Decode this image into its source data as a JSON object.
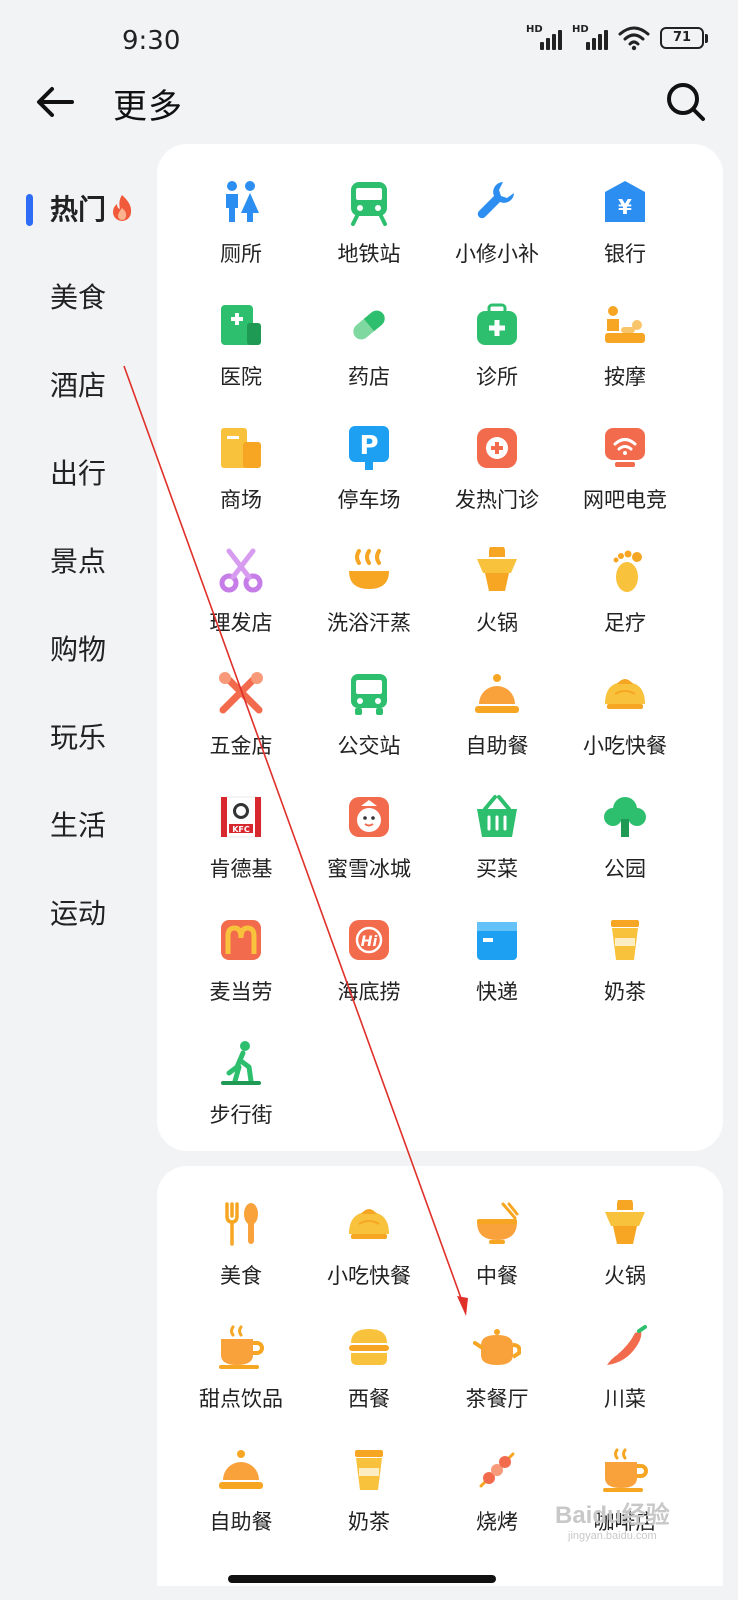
{
  "status_bar": {
    "time": "9:30",
    "signal1_label": "HD",
    "signal2_label": "HD",
    "battery": "71"
  },
  "header": {
    "title": "更多"
  },
  "sidebar": {
    "items": [
      {
        "label": "热门",
        "active": true
      },
      {
        "label": "美食"
      },
      {
        "label": "酒店"
      },
      {
        "label": "出行"
      },
      {
        "label": "景点"
      },
      {
        "label": "购物"
      },
      {
        "label": "玩乐"
      },
      {
        "label": "生活"
      },
      {
        "label": "运动"
      }
    ]
  },
  "hot_section": {
    "items": [
      {
        "label": "厕所",
        "icon": "toilet-icon"
      },
      {
        "label": "地铁站",
        "icon": "subway-icon"
      },
      {
        "label": "小修小补",
        "icon": "wrench-icon"
      },
      {
        "label": "银行",
        "icon": "bank-icon"
      },
      {
        "label": "医院",
        "icon": "hospital-icon"
      },
      {
        "label": "药店",
        "icon": "pill-icon"
      },
      {
        "label": "诊所",
        "icon": "clinic-icon"
      },
      {
        "label": "按摩",
        "icon": "massage-icon"
      },
      {
        "label": "商场",
        "icon": "mall-icon"
      },
      {
        "label": "停车场",
        "icon": "parking-icon"
      },
      {
        "label": "发热门诊",
        "icon": "fever-clinic-icon"
      },
      {
        "label": "网吧电竞",
        "icon": "internet-cafe-icon"
      },
      {
        "label": "理发店",
        "icon": "scissors-icon"
      },
      {
        "label": "洗浴汗蒸",
        "icon": "bath-icon"
      },
      {
        "label": "火锅",
        "icon": "hotpot-icon"
      },
      {
        "label": "足疗",
        "icon": "foot-icon"
      },
      {
        "label": "五金店",
        "icon": "hardware-icon"
      },
      {
        "label": "公交站",
        "icon": "bus-icon"
      },
      {
        "label": "自助餐",
        "icon": "buffet-icon"
      },
      {
        "label": "小吃快餐",
        "icon": "bun-icon"
      },
      {
        "label": "肯德基",
        "icon": "kfc-logo-icon",
        "logo_text": "KFC"
      },
      {
        "label": "蜜雪冰城",
        "icon": "snowman-icon"
      },
      {
        "label": "买菜",
        "icon": "basket-icon"
      },
      {
        "label": "公园",
        "icon": "tree-icon"
      },
      {
        "label": "麦当劳",
        "icon": "mcdonalds-logo-icon",
        "logo_text": "M"
      },
      {
        "label": "海底捞",
        "icon": "haidilao-logo-icon",
        "logo_text": "Hi"
      },
      {
        "label": "快递",
        "icon": "parcel-icon"
      },
      {
        "label": "奶茶",
        "icon": "milk-tea-icon"
      },
      {
        "label": "步行街",
        "icon": "pedestrian-icon"
      }
    ]
  },
  "food_section": {
    "items": [
      {
        "label": "美食",
        "icon": "fork-spoon-icon"
      },
      {
        "label": "小吃快餐",
        "icon": "bun-icon"
      },
      {
        "label": "中餐",
        "icon": "bowl-icon"
      },
      {
        "label": "火锅",
        "icon": "hotpot-icon"
      },
      {
        "label": "甜点饮品",
        "icon": "coffee-cup-icon"
      },
      {
        "label": "西餐",
        "icon": "burger-icon"
      },
      {
        "label": "茶餐厅",
        "icon": "teapot-icon"
      },
      {
        "label": "川菜",
        "icon": "chili-icon"
      },
      {
        "label": "自助餐",
        "icon": "buffet-icon"
      },
      {
        "label": "奶茶",
        "icon": "milk-tea-icon"
      },
      {
        "label": "烧烤",
        "icon": "bbq-icon"
      },
      {
        "label": "咖啡店",
        "icon": "coffee-cup-icon"
      }
    ]
  },
  "watermark": {
    "text": "Baidu经验",
    "sub": "jingyan.baidu.com"
  },
  "colors": {
    "accent": "#2f6df6",
    "annotation": "#e0302a"
  }
}
